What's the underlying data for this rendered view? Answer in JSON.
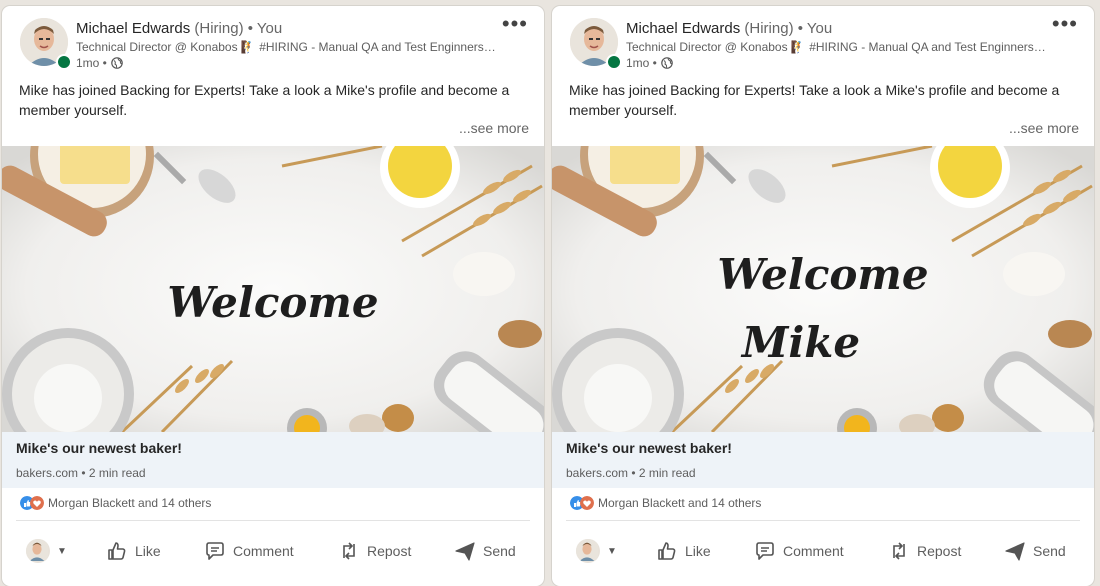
{
  "posts": [
    {
      "author": {
        "name": "Michael Edwards",
        "hiring": "(Hiring)",
        "you": "• You"
      },
      "headline": "Technical Director @ Konabos 🧗 #HIRING - Manual QA and Test Enginners ...",
      "time": "1mo •",
      "body": "Mike has joined Backing for Experts! Take a look a Mike's profile and become a member yourself.",
      "see_more": "...see more",
      "image_text": [
        "Welcome"
      ],
      "article": {
        "title": "Mike's our newest baker!",
        "meta": "bakers.com • 2 min read"
      },
      "reactions": "Morgan Blackett and 14 others",
      "actions": {
        "like": "Like",
        "comment": "Comment",
        "repost": "Repost",
        "send": "Send"
      }
    },
    {
      "author": {
        "name": "Michael Edwards",
        "hiring": "(Hiring)",
        "you": "• You"
      },
      "headline": "Technical Director @ Konabos 🧗 #HIRING - Manual QA and Test Enginners ...",
      "time": "1mo •",
      "body": "Mike has joined Backing for Experts! Take a look a Mike's profile and become a member yourself.",
      "see_more": "...see more",
      "image_text": [
        "Welcome",
        "Mike"
      ],
      "article": {
        "title": "Mike's our newest baker!",
        "meta": "bakers.com • 2 min read"
      },
      "reactions": "Morgan Blackett and 14 others",
      "actions": {
        "like": "Like",
        "comment": "Comment",
        "repost": "Repost",
        "send": "Send"
      }
    }
  ],
  "icons": {
    "globe": "globe-icon",
    "more": "more-options-icon",
    "like": "thumbs-up-icon",
    "comment": "comment-bubble-icon",
    "repost": "repost-arrows-icon",
    "send": "send-plane-icon"
  },
  "colors": {
    "online": "#057642",
    "article_bg": "#eef3f8",
    "like_blue": "#378fe9",
    "love_red": "#df704d"
  }
}
